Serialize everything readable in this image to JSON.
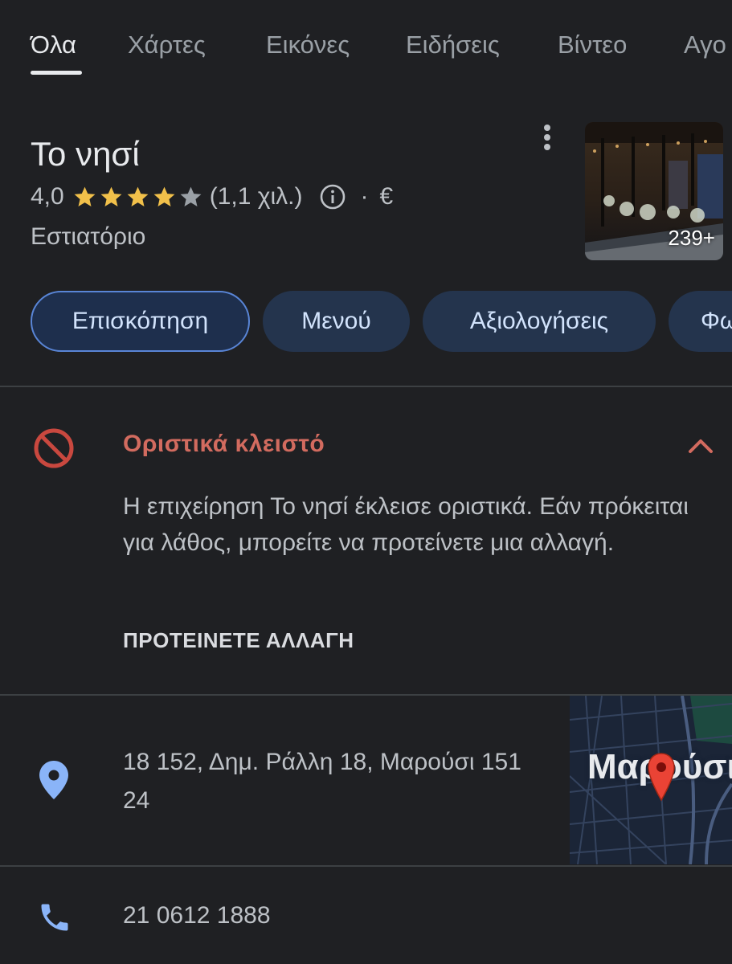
{
  "tabs": [
    {
      "label": "Όλα",
      "active": true
    },
    {
      "label": "Χάρτες"
    },
    {
      "label": "Εικόνες"
    },
    {
      "label": "Ειδήσεις"
    },
    {
      "label": "Βίντεο"
    },
    {
      "label": "Αγο"
    }
  ],
  "place": {
    "name": "Το νησί",
    "rating": "4,0",
    "rating_value": 4.0,
    "stars_max": 5,
    "review_count": "(1,1 χιλ.)",
    "price_separator": "·",
    "price": "€",
    "category": "Εστιατόριο",
    "photo_count": "239+"
  },
  "chips": [
    {
      "label": "Επισκόπηση",
      "active": true
    },
    {
      "label": "Μενού"
    },
    {
      "label": "Αξιολογήσεις"
    },
    {
      "label": "Φω"
    }
  ],
  "closed_notice": {
    "title": "Οριστικά κλειστό",
    "description": "Η επιχείρηση Το νησί έκλεισε οριστικά. Εάν πρόκειται για λάθος, μπορείτε να προτείνετε μια αλλαγή.",
    "action": "ΠΡΟΤΕΙΝΕΤΕ ΑΛΛΑΓΗ"
  },
  "address": {
    "text": "18 152, Δημ. Ράλλη 18, Μαρούσι 151 24",
    "map_label": "Μαρούσι"
  },
  "phone": "21 0612 1888",
  "icons": {
    "more": "more-vert-icon",
    "info": "info-icon",
    "closed": "block-icon",
    "collapse": "chevron-up-icon",
    "location": "location-pin-icon",
    "phone": "phone-icon"
  },
  "colors": {
    "background": "#1f2023",
    "star": "#f1c04a",
    "closed": "#d26b5f",
    "chip_bg": "#24344d",
    "chip_border": "#5985d6",
    "accent_blue": "#8ab4f8",
    "map_pin": "#ea4335"
  }
}
